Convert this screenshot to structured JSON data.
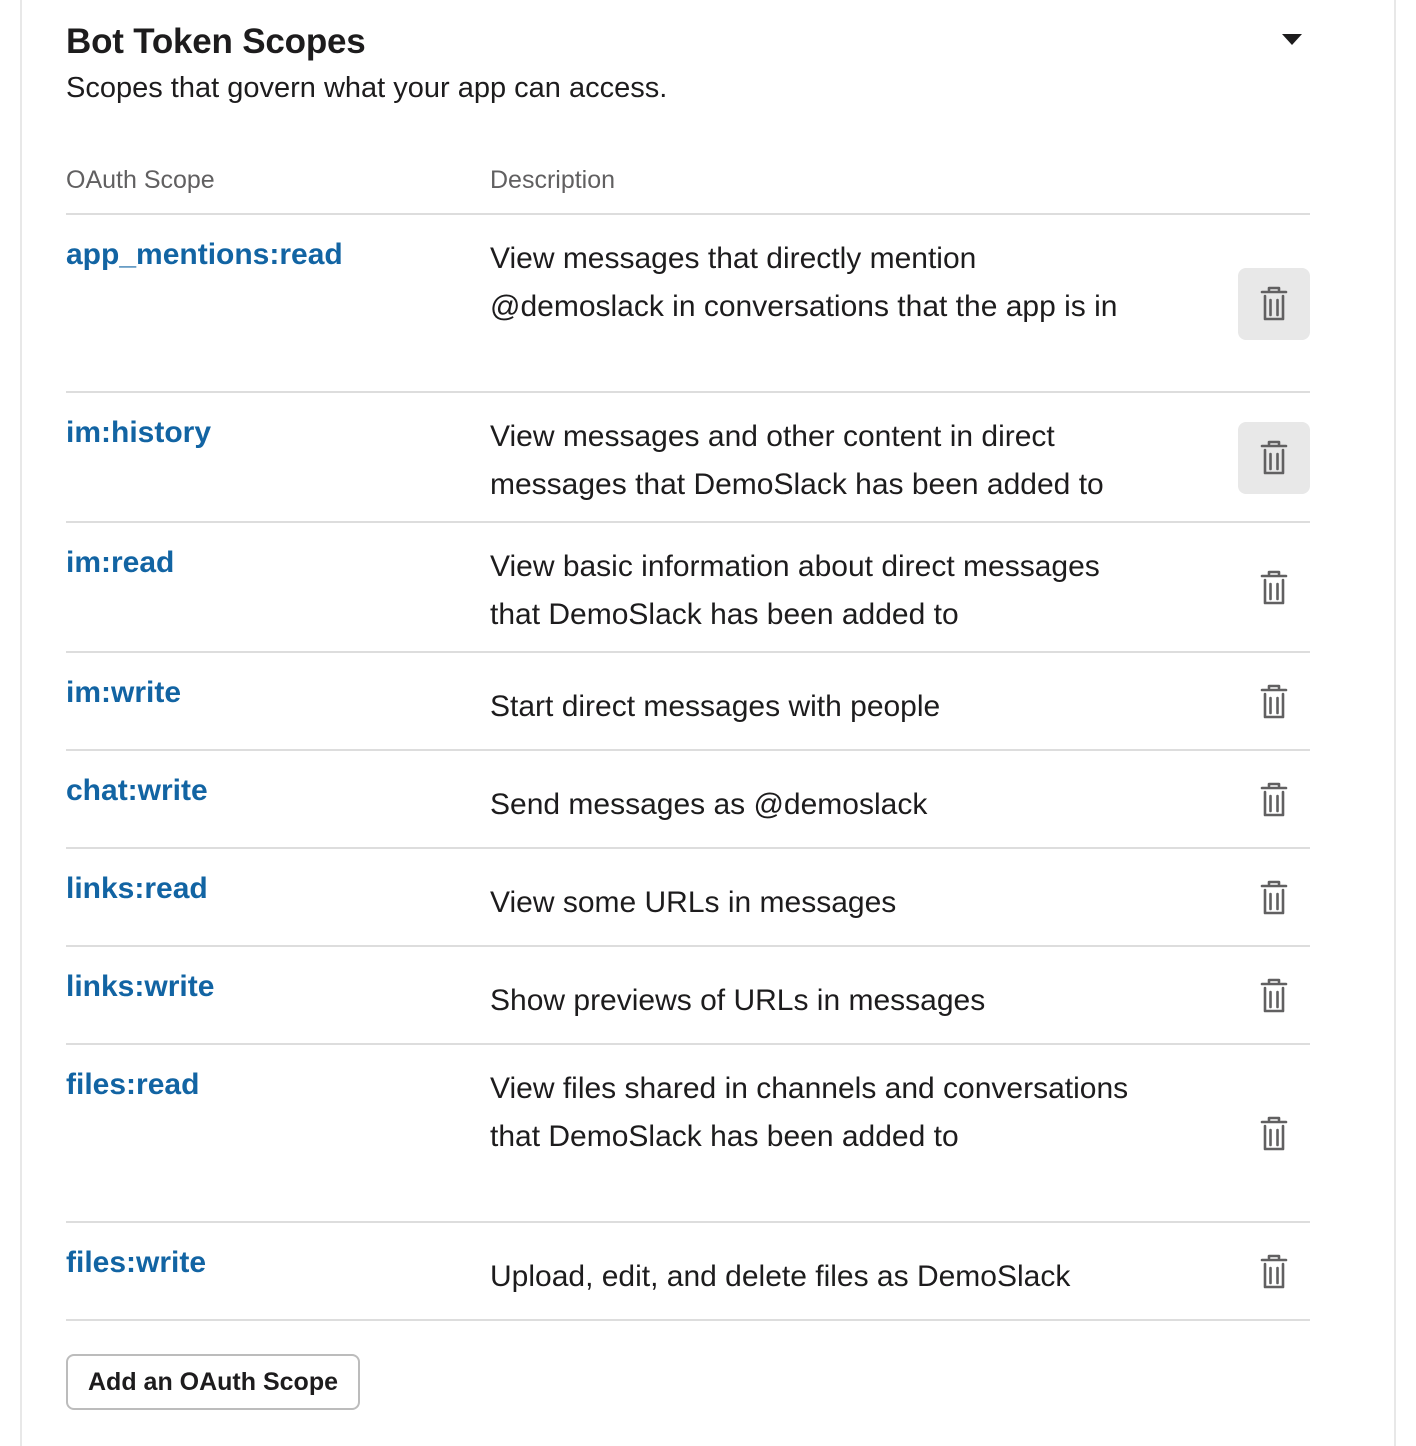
{
  "section": {
    "title": "Bot Token Scopes",
    "subtitle": "Scopes that govern what your app can access."
  },
  "table": {
    "headers": {
      "scope": "OAuth Scope",
      "description": "Description"
    },
    "rows": [
      {
        "scope": "app_mentions:read",
        "description": "View messages that directly mention @demoslack in conversations that the app is in"
      },
      {
        "scope": "im:history",
        "description": "View messages and other content in direct messages that DemoSlack has been added to"
      },
      {
        "scope": "im:read",
        "description": "View basic information about direct messages that DemoSlack has been added to"
      },
      {
        "scope": "im:write",
        "description": "Start direct messages with people"
      },
      {
        "scope": "chat:write",
        "description": "Send messages as @demoslack"
      },
      {
        "scope": "links:read",
        "description": "View some URLs in messages"
      },
      {
        "scope": "links:write",
        "description": "Show previews of URLs in messages"
      },
      {
        "scope": "files:read",
        "description": "View files shared in channels and conversations that DemoSlack has been added to"
      },
      {
        "scope": "files:write",
        "description": "Upload, edit, and delete files as DemoSlack"
      }
    ]
  },
  "actions": {
    "add_scope_label": "Add an OAuth Scope"
  },
  "icons": {
    "collapse": "caret-down-icon",
    "delete": "trash-icon"
  },
  "colors": {
    "link": "#1264a3",
    "text": "#1d1c1d",
    "muted": "#616061",
    "divider": "#dddddd"
  }
}
